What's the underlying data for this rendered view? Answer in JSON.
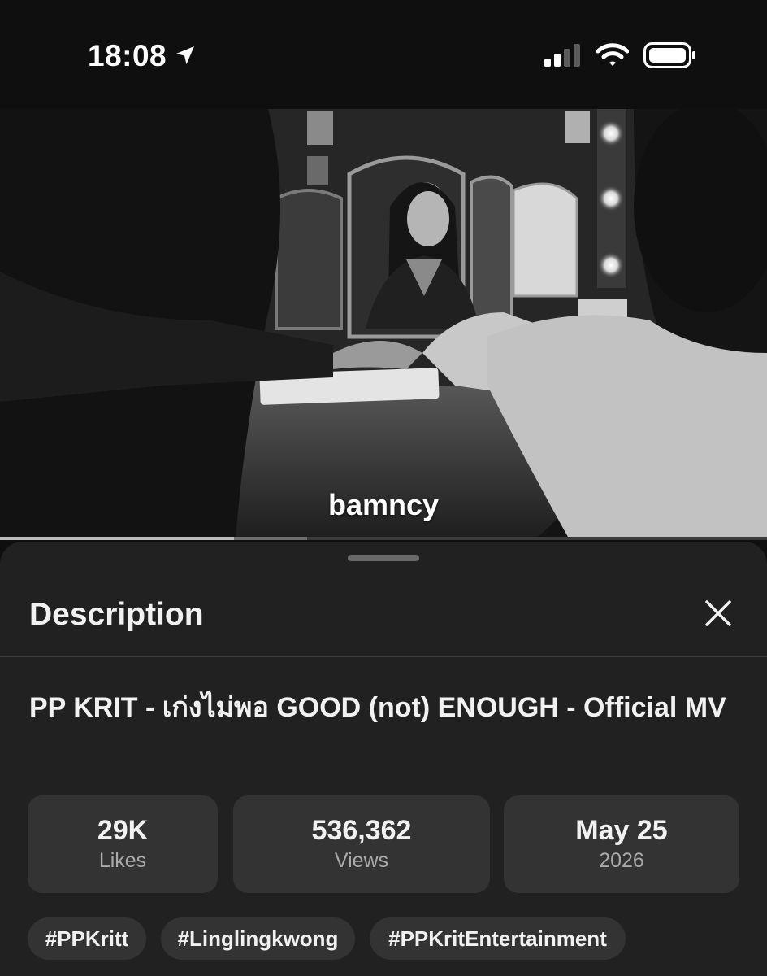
{
  "status_bar": {
    "time": "18:08",
    "icons": [
      "location-arrow-icon",
      "cellular-signal-icon",
      "wifi-icon",
      "battery-icon"
    ]
  },
  "video": {
    "caption": "bamncy",
    "progress_played": 0.305,
    "progress_buffered": 0.4
  },
  "description_panel": {
    "title": "Description",
    "close_icon": "close-icon",
    "video_title": "PP KRIT - เก่งไม่พอ GOOD (not) ENOUGH - Official MV",
    "stats": [
      {
        "value": "29K",
        "label": "Likes"
      },
      {
        "value": "536,362",
        "label": "Views"
      },
      {
        "value": "May 25",
        "label": "2026"
      }
    ],
    "hashtags": [
      "#PPKritt",
      "#Linglingkwong",
      "#PPKritEntertainment"
    ]
  },
  "colors": {
    "background": "#0f0f0f",
    "sheet": "#212121",
    "chip": "#333333",
    "text_primary": "#f1f1f1",
    "text_secondary": "#aaaaaa"
  }
}
